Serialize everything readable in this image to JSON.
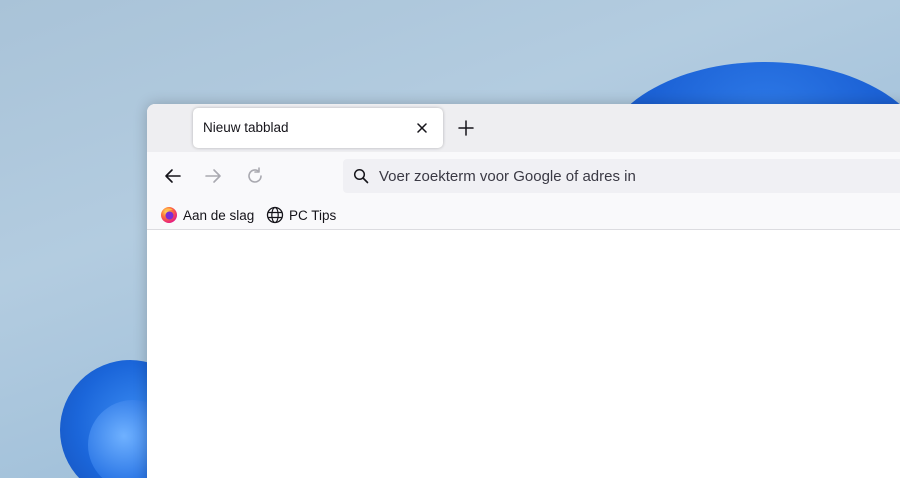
{
  "browser": {
    "tab": {
      "title": "Nieuw tabblad",
      "close_icon": "close-icon"
    },
    "newtab_icon": "plus-icon",
    "nav": {
      "back_icon": "arrow-left-icon",
      "forward_icon": "arrow-right-icon",
      "reload_icon": "reload-icon"
    },
    "urlbar": {
      "placeholder": "Voer zoekterm voor Google of adres in",
      "value": "",
      "icon": "search-icon"
    },
    "bookmarks": [
      {
        "label": "Aan de slag",
        "icon": "firefox-logo-icon"
      },
      {
        "label": "PC Tips",
        "icon": "globe-icon"
      }
    ]
  },
  "colors": {
    "tabbar": "#eeeef1",
    "toolbar": "#f9f9fb",
    "urlbar": "#f0f0f4",
    "wallpaper_accent": "#1c62d6"
  }
}
